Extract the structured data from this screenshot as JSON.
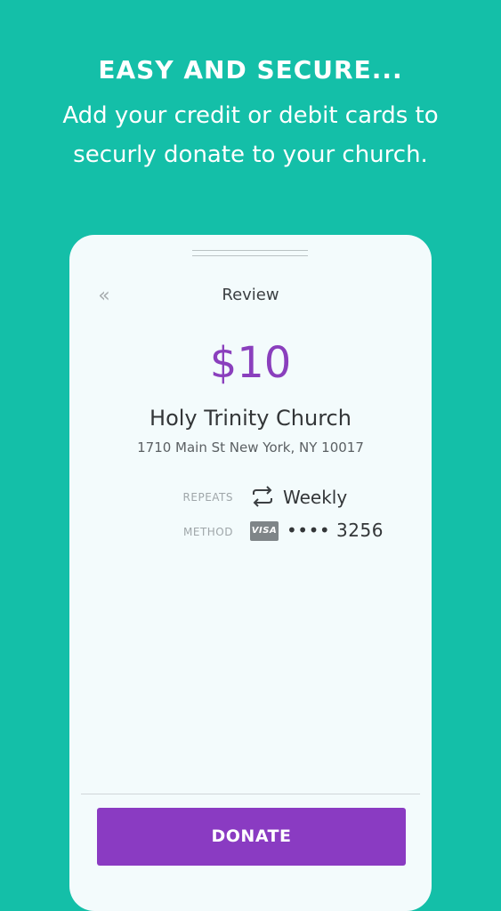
{
  "promo": {
    "headline": "EASY AND SECURE...",
    "subtext": "Add your credit or debit cards to securly donate to your church."
  },
  "screen": {
    "back_icon": "«",
    "title": "Review",
    "amount": "$10",
    "church_name": "Holy Trinity Church",
    "church_address": "1710 Main St New York, NY 10017"
  },
  "details": {
    "repeats_label": "REPEATS",
    "repeats_value": "Weekly",
    "method_label": "METHOD",
    "card_brand": "VISA",
    "card_masked": "•••• 3256"
  },
  "actions": {
    "donate_label": "DONATE"
  },
  "colors": {
    "background": "#14bfa8",
    "accent_purple": "#8a3bc2",
    "card_surface": "#f3fbfc"
  },
  "icons": {
    "back": "double-chevron-left-icon",
    "repeat": "repeat-icon",
    "card": "visa-card-icon"
  }
}
